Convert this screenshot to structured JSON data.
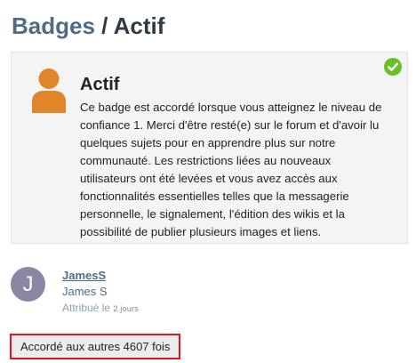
{
  "header": {
    "crumb": "Badges",
    "separator": "/",
    "current": "Actif"
  },
  "badge": {
    "title": "Actif",
    "description": "Ce badge est accordé lorsque vous atteignez le niveau de confiance 1. Merci d'être resté(e) sur le forum et d'avoir lu quelques sujets pour en apprendre plus sur notre communauté. Les restrictions liées au nouveaux utilisateurs ont été levées et vous avez accès aux fonctionnalités essentielles telles que la messagerie personnelle, le signalement, l'édition des wikis et la possibilité de publier plusieurs images et liens.",
    "icon": "user-icon",
    "icon_color": "#e0852a",
    "granted_icon": "check-circle-icon",
    "granted_icon_color": "#6bbf2c"
  },
  "user": {
    "avatar_letter": "J",
    "avatar_color": "#8a86a3",
    "username": "JamesS",
    "full_name": "James S",
    "granted_label": "Attribué le",
    "granted_date": "2 jours"
  },
  "footer": {
    "granted_count": "Accordé aux autres 4607 fois"
  }
}
